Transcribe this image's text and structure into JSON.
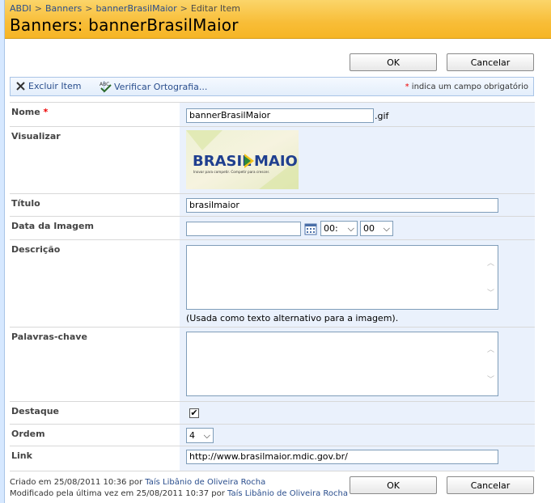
{
  "breadcrumb": {
    "items": [
      "ABDI",
      "Banners",
      "bannerBrasilMaior"
    ],
    "current": "Editar Item",
    "separator": ">"
  },
  "title": "Banners: bannerBrasilMaior",
  "buttons": {
    "ok": "OK",
    "cancel": "Cancelar"
  },
  "toolbar": {
    "delete_label": "Excluir Item",
    "spell_label": "Verificar Ortografia...",
    "required_star": "*",
    "required_note": "indica um campo obrigatório"
  },
  "fields": {
    "nome": {
      "label": "Nome",
      "required_star": "*",
      "value": "bannerBrasilMaior",
      "ext": ".gif"
    },
    "visualizar": {
      "label": "Visualizar",
      "logo_text": "BRASIL MAIOR",
      "logo_sub": "Inovar para competir. Competir para crescer."
    },
    "titulo": {
      "label": "Título",
      "value": "brasilmaior"
    },
    "data": {
      "label": "Data da Imagem",
      "value": "",
      "hour": "00:",
      "minute": "00"
    },
    "descricao": {
      "label": "Descrição",
      "value": "",
      "note": "(Usada como texto alternativo para a imagem)."
    },
    "palavras": {
      "label": "Palavras-chave",
      "value": ""
    },
    "destaque": {
      "label": "Destaque",
      "checked": true,
      "check_glyph": "✔"
    },
    "ordem": {
      "label": "Ordem",
      "value": "4"
    },
    "link": {
      "label": "Link",
      "value": "http://www.brasilmaior.mdic.gov.br/"
    }
  },
  "footer": {
    "created_prefix": "Criado em 25/08/2011 10:36  por",
    "created_by": "Taís Libânio de Oliveira Rocha",
    "modified_prefix": "Modificado pela última vez em 25/08/2011 10:37  por",
    "modified_by": "Taís Libânio de Oliveira Rocha"
  },
  "colors": {
    "header": "#f8bd37",
    "accent": "#2a4e8d",
    "value_bg": "#eaf1fc",
    "required": "#e00000"
  }
}
